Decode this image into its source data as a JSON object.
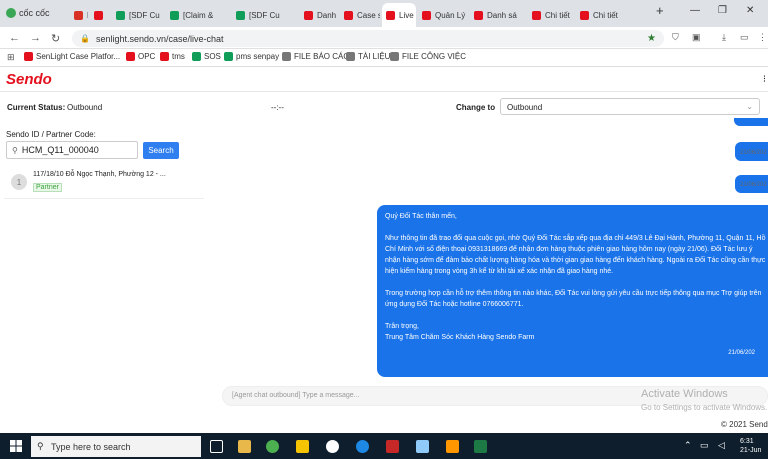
{
  "browser": {
    "logo_text": "cốc cốc",
    "tabs": [
      {
        "label": "M",
        "color": "#d93025"
      },
      {
        "label": "",
        "color": "#e5101d"
      },
      {
        "label": "[SDF Cu",
        "color": "#0f9d58"
      },
      {
        "label": "[Claim &",
        "color": "#0f9d58"
      },
      {
        "label": "[SDF Cu",
        "color": "#0f9d58"
      },
      {
        "label": "Danh sá",
        "color": "#e5101d"
      },
      {
        "label": "Case sy",
        "color": "#e5101d"
      },
      {
        "label": "Live",
        "color": "#e5101d",
        "active": true
      },
      {
        "label": "Quản Lý",
        "color": "#e5101d"
      },
      {
        "label": "Danh sá",
        "color": "#e5101d"
      },
      {
        "label": "Chi tiết",
        "color": "#e5101d"
      },
      {
        "label": "Chi tiết",
        "color": "#e5101d"
      }
    ],
    "new_tab": "+",
    "url": "senlight.sendo.vn/case/live-chat",
    "bookmarks": [
      {
        "label": "SenLight Case Platfor...",
        "color": "#e5101d"
      },
      {
        "label": "OPC",
        "color": "#e5101d"
      },
      {
        "label": "tms",
        "color": "#e5101d"
      },
      {
        "label": "SOS",
        "color": "#0f9d58"
      },
      {
        "label": "pms senpay",
        "color": "#0f9d58"
      },
      {
        "label": "FILE BÁO CÁO",
        "color": "#777"
      },
      {
        "label": "TÀI LIỆU",
        "color": "#777"
      },
      {
        "label": "FILE CÔNG VIỆC",
        "color": "#777"
      }
    ]
  },
  "app": {
    "logo": "Sendo",
    "current_status_label": "Current Status:",
    "current_status_value": "Outbound",
    "status_separator": "--:--",
    "change_to_label": "Change to",
    "change_to_value": "Outbound",
    "search_label": "Sendo ID / Partner Code:",
    "search_value": "HCM_Q11_000040",
    "search_button": "Search",
    "list": [
      {
        "index": "1",
        "address": "117/18/10 Đỗ Ngọc Thạnh, Phường 12 - ...",
        "badge": "Partner"
      }
    ],
    "chat": {
      "timestamps": [
        "21/06/202",
        "21/06/202"
      ],
      "message": {
        "greeting": "Quý Đối Tác thân mến,",
        "body1": "Như thông tin đã trao đổi qua cuộc gọi, nhờ Quý Đối Tác sắp xếp qua địa chỉ 449/3 Lê Đại Hành, Phường 11, Quận 11, Hồ Chí Minh với số điện thoại 0931318669 để nhận đơn hàng thuộc phiên giao hàng hôm nay (ngày 21/06). Đối Tác lưu ý nhận hàng sớm để đảm bảo chất lượng hàng hóa và thời gian giao hàng đến khách hàng. Ngoài ra Đối Tác cũng cần thực hiện kiểm hàng trong vòng 3h kể từ khi tài xế xác nhận đã giao hàng nhé.",
        "body2": "Trong trường hợp cần hỗ trợ thêm thông tin nào khác, Đối Tác vui lòng gửi yêu cầu trực tiếp thông qua mục Trợ giúp trên ứng dụng Đối Tác hoặc hotline 0766006771.",
        "signoff": "Trân trọng,",
        "signature": "Trung Tâm Chăm Sóc Khách Hàng Sendo Farm",
        "time": "21/06/202"
      },
      "composer_placeholder": "[Agent chat outbound] Type a message..."
    },
    "footer": "© 2021 Sendo"
  },
  "overlay": {
    "activate_title": "Activate Windows",
    "activate_sub": "Go to Settings to activate Windows."
  },
  "taskbar": {
    "search_placeholder": "Type here to search",
    "time": "6:31",
    "date": "21-Jun"
  }
}
